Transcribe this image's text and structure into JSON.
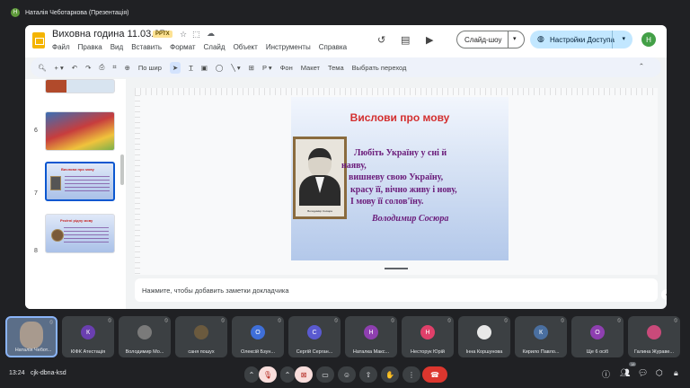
{
  "meet": {
    "presenter_initial": "Н",
    "presenter_label": "Наталія Чеботаркова (Презентація)",
    "time": "13:24",
    "meeting_code": "cjk-dbna-ksd",
    "participants_count": "18"
  },
  "slides_app": {
    "title": "Виховна година 11.03.25",
    "file_badge": "PPTX",
    "menu": [
      "Файл",
      "Правка",
      "Вид",
      "Вставить",
      "Формат",
      "Слайд",
      "Объект",
      "Инструменты",
      "Справка"
    ],
    "slideshow_label": "Слайд-шоу",
    "share_label": "Настройки Доступа",
    "user_initial": "H",
    "toolbar": {
      "zoom": "По шир",
      "background": "Фон",
      "layout": "Макет",
      "theme": "Тема",
      "transition": "Выбрать переход"
    },
    "thumbs": [
      {
        "num": "6"
      },
      {
        "num": "7",
        "title": "Вислови про мову"
      },
      {
        "num": "8",
        "title": "Рекітні рідну мову"
      }
    ],
    "notes_placeholder": "Нажмите, чтобы добавить заметки докладчика"
  },
  "slide": {
    "title": "Вислови про мову",
    "poem_lines": [
      "Любіть Україну у сні й",
      "наяву,",
      "вишневу свою Україну,",
      "красу її, вічно живу і нову,",
      "І   мову її солов'їну."
    ],
    "author": "Володимир Сосюра",
    "portrait_caption": "Володимир Сосюра"
  },
  "tiles": [
    {
      "name": "Наталія Чебот...",
      "initial": "",
      "color": "#a89a8e",
      "me": true
    },
    {
      "name": "КІФК Атестація",
      "initial": "К",
      "color": "#6a3fb0"
    },
    {
      "name": "Володимир Мо...",
      "initial": "",
      "color": "#7a7a7a"
    },
    {
      "name": "саня пошух",
      "initial": "",
      "color": "#6b5a3e"
    },
    {
      "name": "Олексій Бзун...",
      "initial": "О",
      "color": "#3f6fd8"
    },
    {
      "name": "Сергій Серган...",
      "initial": "С",
      "color": "#5a5ad0"
    },
    {
      "name": "Наталка Макс...",
      "initial": "Н",
      "color": "#8e3fb0"
    },
    {
      "name": "Несторук Юрій",
      "initial": "Н",
      "color": "#e0406a"
    },
    {
      "name": "Інна Коршунова",
      "initial": "",
      "color": "#e8e8e8"
    },
    {
      "name": "Кирило Павло...",
      "initial": "К",
      "color": "#4a6fa0"
    },
    {
      "name": "Ще 6 осіб",
      "initial": "О",
      "color": "#8e3fb0"
    },
    {
      "name": "Галина Жураве...",
      "initial": "",
      "color": "#c94a7a"
    }
  ]
}
